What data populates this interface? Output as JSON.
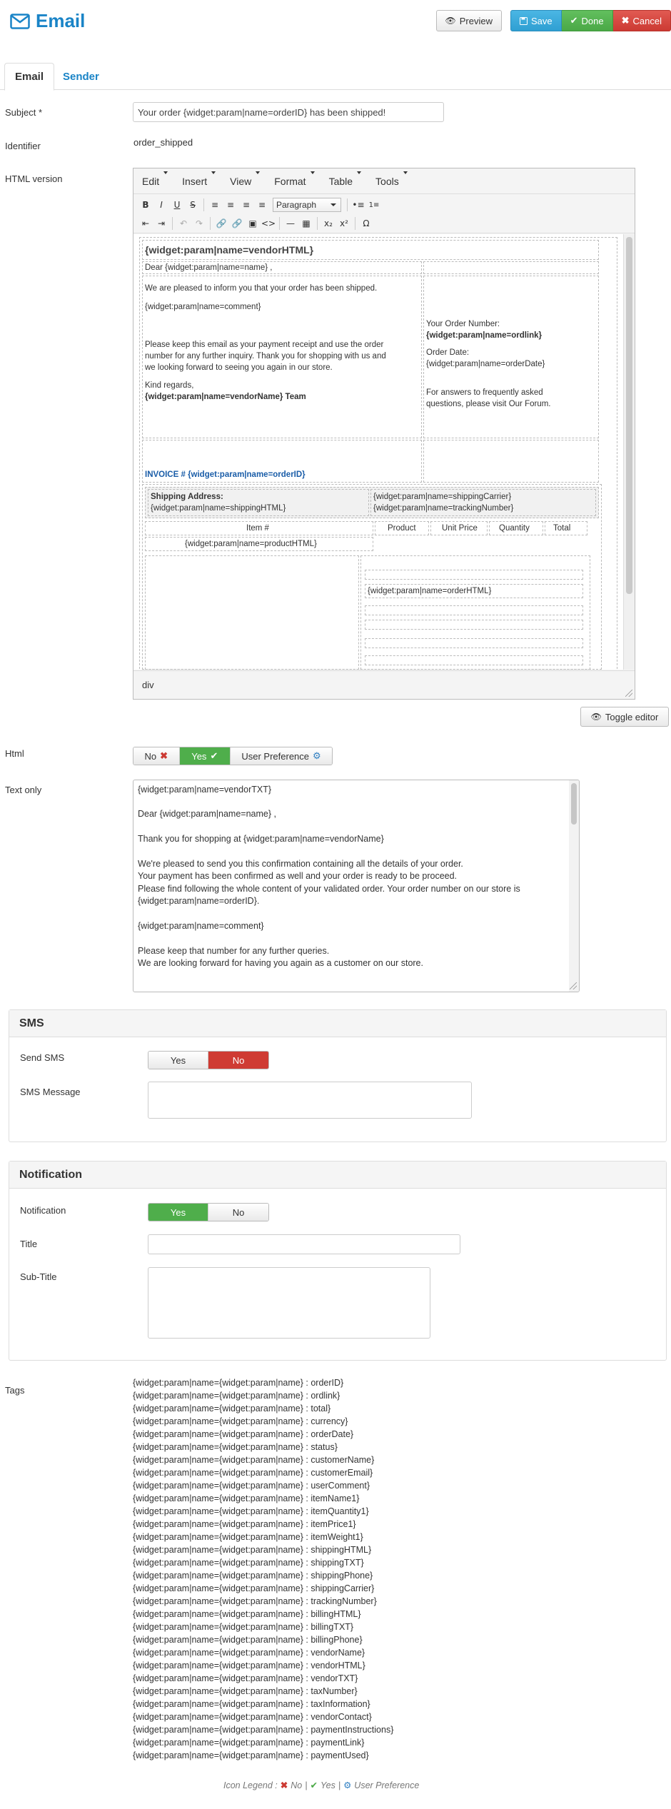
{
  "header": {
    "title": "Email",
    "preview_label": "Preview",
    "save_label": "Save",
    "done_label": "Done",
    "cancel_label": "Cancel"
  },
  "tabs": [
    {
      "label": "Email",
      "active": true
    },
    {
      "label": "Sender",
      "active": false
    }
  ],
  "form": {
    "subject_label": "Subject *",
    "subject_value": "Your order {widget:param|name=orderID} has been shipped!",
    "identifier_label": "Identifier",
    "identifier_value": "order_shipped",
    "html_version_label": "HTML version"
  },
  "editor": {
    "menu": [
      "Edit",
      "Insert",
      "View",
      "Format",
      "Table",
      "Tools"
    ],
    "format_select": "Paragraph",
    "statusbar_path": "div",
    "content": {
      "vendor_html": "{widget:param|name=vendorHTML}",
      "dear_line": "Dear {widget:param|name=name} ,",
      "informed_line": "We are pleased to inform you that your order has been shipped.",
      "comment": "{widget:param|name=comment}",
      "receipt_1": "Please keep this email as your payment receipt and use the order",
      "receipt_2": "number for any further inquiry. Thank you for shopping with us and",
      "receipt_3": "we looking forward to seeing you again in our store.",
      "kind_regards": "Kind regards,",
      "team": "{widget:param|name=vendorName} Team",
      "order_number_label": "Your Order Number:",
      "order_link": "{widget:param|name=ordlink}",
      "order_date_label": "Order Date:",
      "order_date": "{widget:param|name=orderDate}",
      "answers_1": "For answers to frequently asked",
      "answers_2": "questions, please visit Our Forum.",
      "invoice": "INVOICE # {widget:param|name=orderID}",
      "shipping_address_label": "Shipping Address:",
      "shipping_html": "{widget:param|name=shippingHTML}",
      "shipping_carrier": "{widget:param|name=shippingCarrier}",
      "tracking_number": "{widget:param|name=trackingNumber}",
      "col_item": "Item #",
      "col_product": "Product",
      "col_unit_price": "Unit Price",
      "col_quantity": "Quantity",
      "col_total": "Total",
      "product_html": "{widget:param|name=productHTML}",
      "order_html": "{widget:param|name=orderHTML}"
    }
  },
  "toggle_editor_label": "Toggle editor",
  "html_option": {
    "label": "Html",
    "no": "No",
    "yes": "Yes",
    "user_pref": "User Preference",
    "selected": "Yes"
  },
  "text_only": {
    "label": "Text only",
    "lines": [
      "{widget:param|name=vendorTXT}",
      "",
      "Dear {widget:param|name=name} ,",
      "",
      "Thank you for shopping at {widget:param|name=vendorName}",
      "",
      "We're pleased to send you this confirmation containing all the details of your order.",
      "Your payment has been confirmed as well and your order is ready to be proceed.",
      "Please find following the whole content of your validated order. Your order number on our store is",
      "{widget:param|name=orderID}.",
      "",
      "{widget:param|name=comment}",
      "",
      "Please keep that number for any further queries.",
      "We are looking forward for having you again as a customer on our store."
    ]
  },
  "sms": {
    "title": "SMS",
    "send_label": "Send SMS",
    "yes": "Yes",
    "no": "No",
    "selected": "No",
    "message_label": "SMS Message",
    "message_value": ""
  },
  "notification": {
    "title": "Notification",
    "notification_label": "Notification",
    "yes": "Yes",
    "no": "No",
    "selected": "Yes",
    "title_label": "Title",
    "title_value": "",
    "subtitle_label": "Sub-Title",
    "subtitle_value": ""
  },
  "tags": {
    "label": "Tags",
    "items": [
      "{widget:param|name={widget:param|name} : orderID}",
      "{widget:param|name={widget:param|name} : ordlink}",
      "{widget:param|name={widget:param|name} : total}",
      "{widget:param|name={widget:param|name} : currency}",
      "{widget:param|name={widget:param|name} : orderDate}",
      "{widget:param|name={widget:param|name} : status}",
      "{widget:param|name={widget:param|name} : customerName}",
      "{widget:param|name={widget:param|name} : customerEmail}",
      "{widget:param|name={widget:param|name} : userComment}",
      "{widget:param|name={widget:param|name} : itemName1}",
      "{widget:param|name={widget:param|name} : itemQuantity1}",
      "{widget:param|name={widget:param|name} : itemPrice1}",
      "{widget:param|name={widget:param|name} : itemWeight1}",
      "{widget:param|name={widget:param|name} : shippingHTML}",
      "{widget:param|name={widget:param|name} : shippingTXT}",
      "{widget:param|name={widget:param|name} : shippingPhone}",
      "{widget:param|name={widget:param|name} : shippingCarrier}",
      "{widget:param|name={widget:param|name} : trackingNumber}",
      "{widget:param|name={widget:param|name} : billingHTML}",
      "{widget:param|name={widget:param|name} : billingTXT}",
      "{widget:param|name={widget:param|name} : billingPhone}",
      "{widget:param|name={widget:param|name} : vendorName}",
      "{widget:param|name={widget:param|name} : vendorHTML}",
      "{widget:param|name={widget:param|name} : vendorTXT}",
      "{widget:param|name={widget:param|name} : taxNumber}",
      "{widget:param|name={widget:param|name} : taxInformation}",
      "{widget:param|name={widget:param|name} : vendorContact}",
      "{widget:param|name={widget:param|name} : paymentInstructions}",
      "{widget:param|name={widget:param|name} : paymentLink}",
      "{widget:param|name={widget:param|name} : paymentUsed}"
    ]
  },
  "icon_legend": {
    "label": "Icon Legend :",
    "no": "No",
    "yes": "Yes",
    "user_pref": "User Preference",
    "separator": "|"
  },
  "colors": {
    "brand_blue": "#1a84c7",
    "save": "#2f9fd2",
    "done": "#4aa846",
    "cancel": "#cc3a33",
    "active_green": "#4fae4b",
    "active_red": "#cf3b33"
  }
}
